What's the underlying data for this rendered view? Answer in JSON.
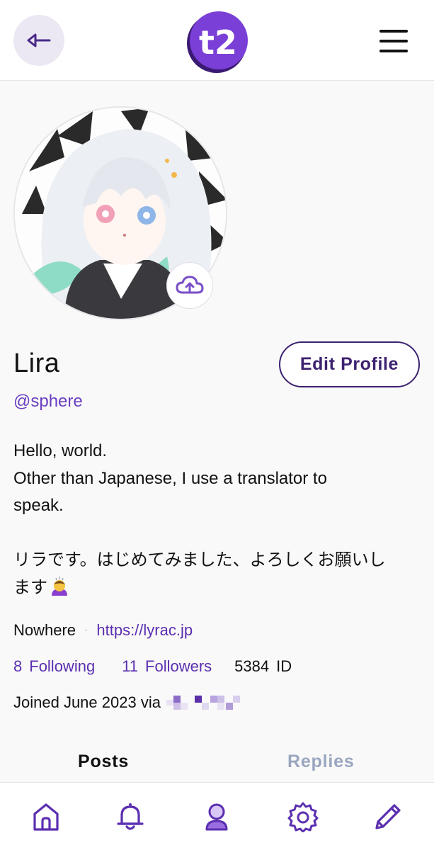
{
  "header": {
    "logo_text": "t2"
  },
  "profile": {
    "display_name": "Lira",
    "handle": "@sphere",
    "edit_button": "Edit Profile",
    "bio_lines": [
      "Hello, world.",
      "Other than Japanese, I use a translator to",
      "speak.",
      "",
      "リラです。はじめてみました、よろしくお願いし",
      "ます"
    ],
    "location": "Nowhere",
    "website": "https://lyrac.jp",
    "following_count": "8",
    "following_label": "Following",
    "followers_count": "11",
    "followers_label": "Followers",
    "id_number": "5384",
    "id_label": "ID",
    "joined_text": "Joined June 2023 via"
  },
  "tabs": [
    {
      "label": "Posts",
      "active": true
    },
    {
      "label": "Replies",
      "active": false
    }
  ],
  "bottom_nav": [
    "home-icon",
    "bell-icon",
    "profile-icon",
    "gear-icon",
    "pencil-icon"
  ],
  "colors": {
    "accent": "#5b2fb0",
    "accent_dark": "#3d2270",
    "inactive_tab": "#9aa6bf"
  }
}
